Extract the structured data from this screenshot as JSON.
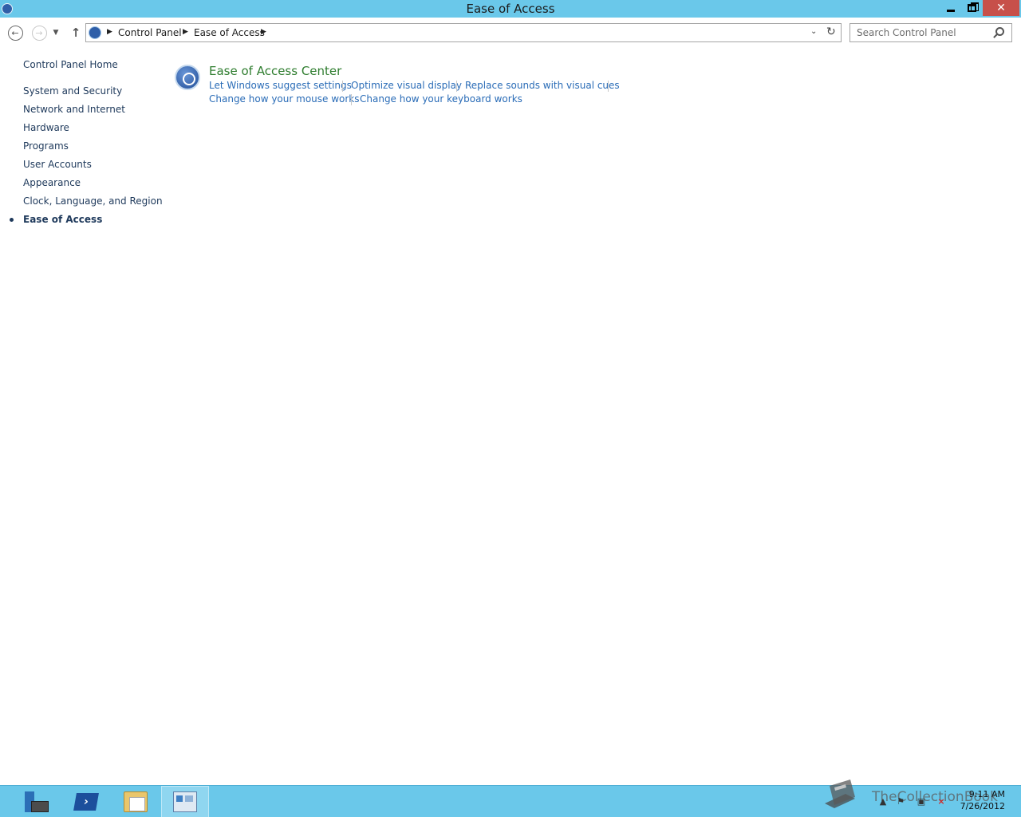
{
  "window": {
    "title": "Ease of Access",
    "minimize_label": "",
    "maximize_label": "",
    "close_label": "✕"
  },
  "navbar": {
    "back_glyph": "←",
    "forward_glyph": "→",
    "recent_glyph": "▼",
    "up_glyph": "↑",
    "breadcrumb": [
      "Control Panel",
      "Ease of Access"
    ],
    "separator_glyph": "▶",
    "dropdown_glyph": "⌄",
    "refresh_glyph": "↻"
  },
  "search": {
    "placeholder": "Search Control Panel",
    "value": ""
  },
  "sidebar": {
    "home": "Control Panel Home",
    "items": [
      {
        "label": "System and Security"
      },
      {
        "label": "Network and Internet"
      },
      {
        "label": "Hardware"
      },
      {
        "label": "Programs"
      },
      {
        "label": "User Accounts"
      },
      {
        "label": "Appearance"
      },
      {
        "label": "Clock, Language, and Region"
      },
      {
        "label": "Ease of Access",
        "active": true
      }
    ]
  },
  "main": {
    "category": {
      "title": "Ease of Access Center",
      "icon": "ease-of-access-icon",
      "title_color": "#2f7d2f",
      "tasks": [
        "Let Windows suggest settings",
        "Optimize visual display",
        "Replace sounds with visual cues",
        "Change how your mouse works",
        "Change how your keyboard works"
      ]
    }
  },
  "taskbar": {
    "apps": [
      {
        "name": "Server Manager",
        "icon": "server-manager-icon"
      },
      {
        "name": "Windows PowerShell",
        "icon": "powershell-icon"
      },
      {
        "name": "File Explorer",
        "icon": "folder-icon"
      },
      {
        "name": "Control Panel",
        "icon": "control-panel-icon",
        "active": true
      }
    ],
    "watermark": "TheCollectionBook",
    "clock": {
      "time": "9:11 AM",
      "date": "7/26/2012"
    },
    "accent_color": "#6ac8ea"
  }
}
